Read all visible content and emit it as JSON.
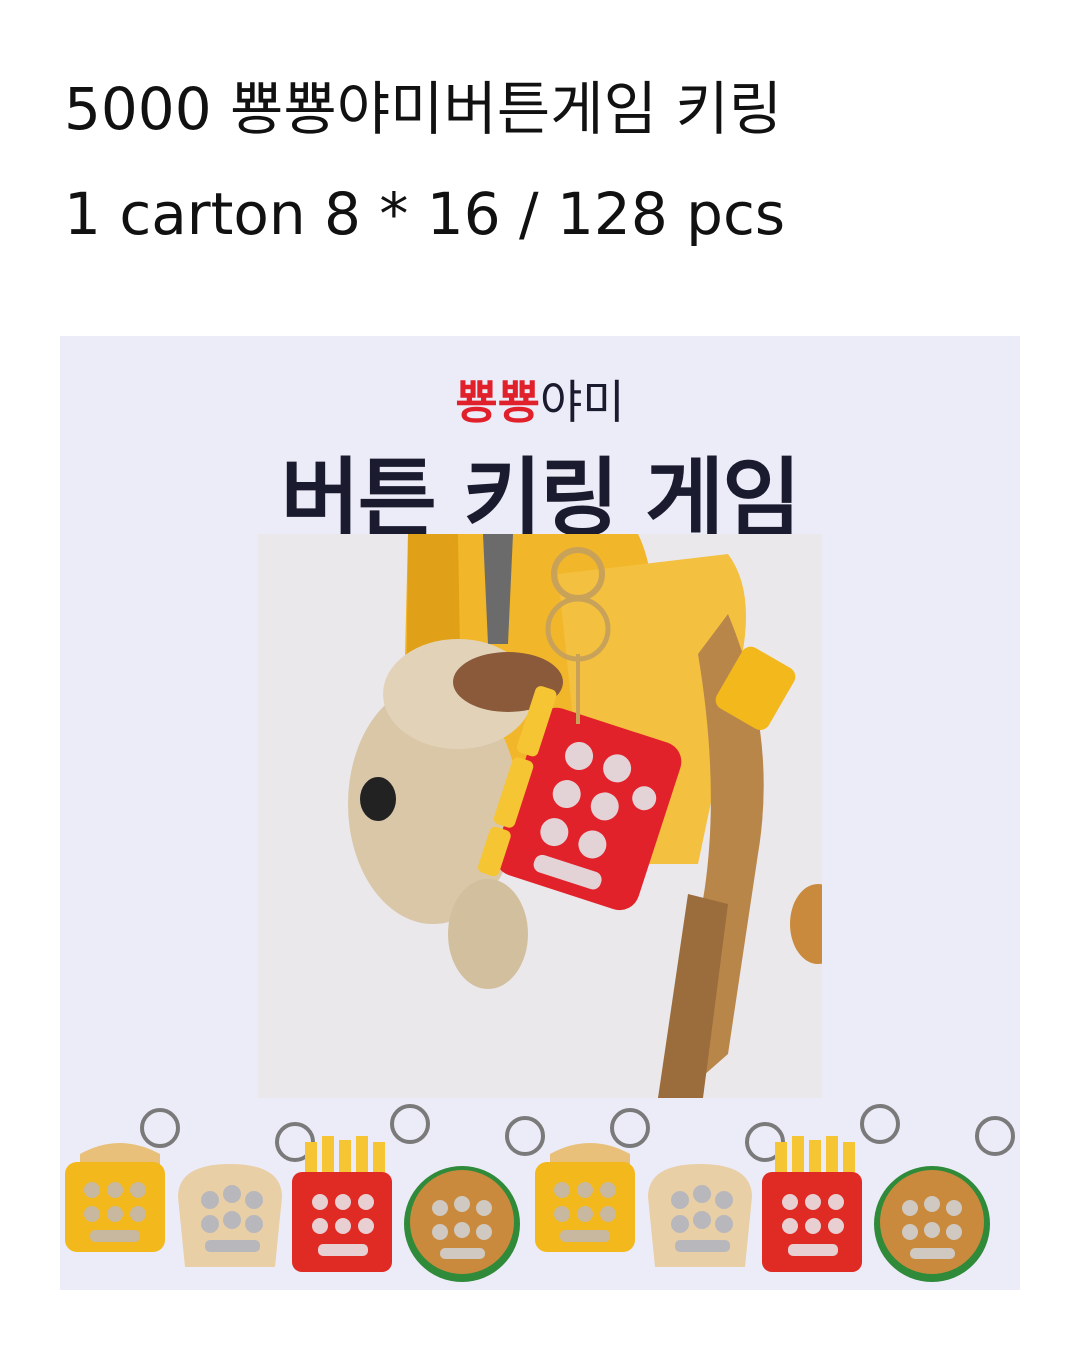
{
  "header": {
    "title": "5000 뿅뿅야미버튼게임 키링",
    "packing": "1 carton 8 * 16 / 128 pcs"
  },
  "banner": {
    "title_red": "뿅뿅",
    "title_dark": "야미",
    "title_main": "버튼 키링 게임"
  },
  "product_photo": {
    "subject": "fries-keyring-on-backpack"
  },
  "keyring_row": {
    "items": [
      "sandwich-keyring",
      "bread-keyring",
      "fries-keyring",
      "burger-keyring",
      "sandwich-keyring",
      "bread-keyring",
      "fries-keyring",
      "burger-keyring"
    ]
  },
  "colors": {
    "title_red": "#e0212b",
    "title_dark": "#1b1b2f",
    "banner_bg": "#ececf8",
    "sandwich": "#f3b81c",
    "bread": "#e9cfa6",
    "fries": "#e02b24",
    "burger": "#c98a3d"
  }
}
